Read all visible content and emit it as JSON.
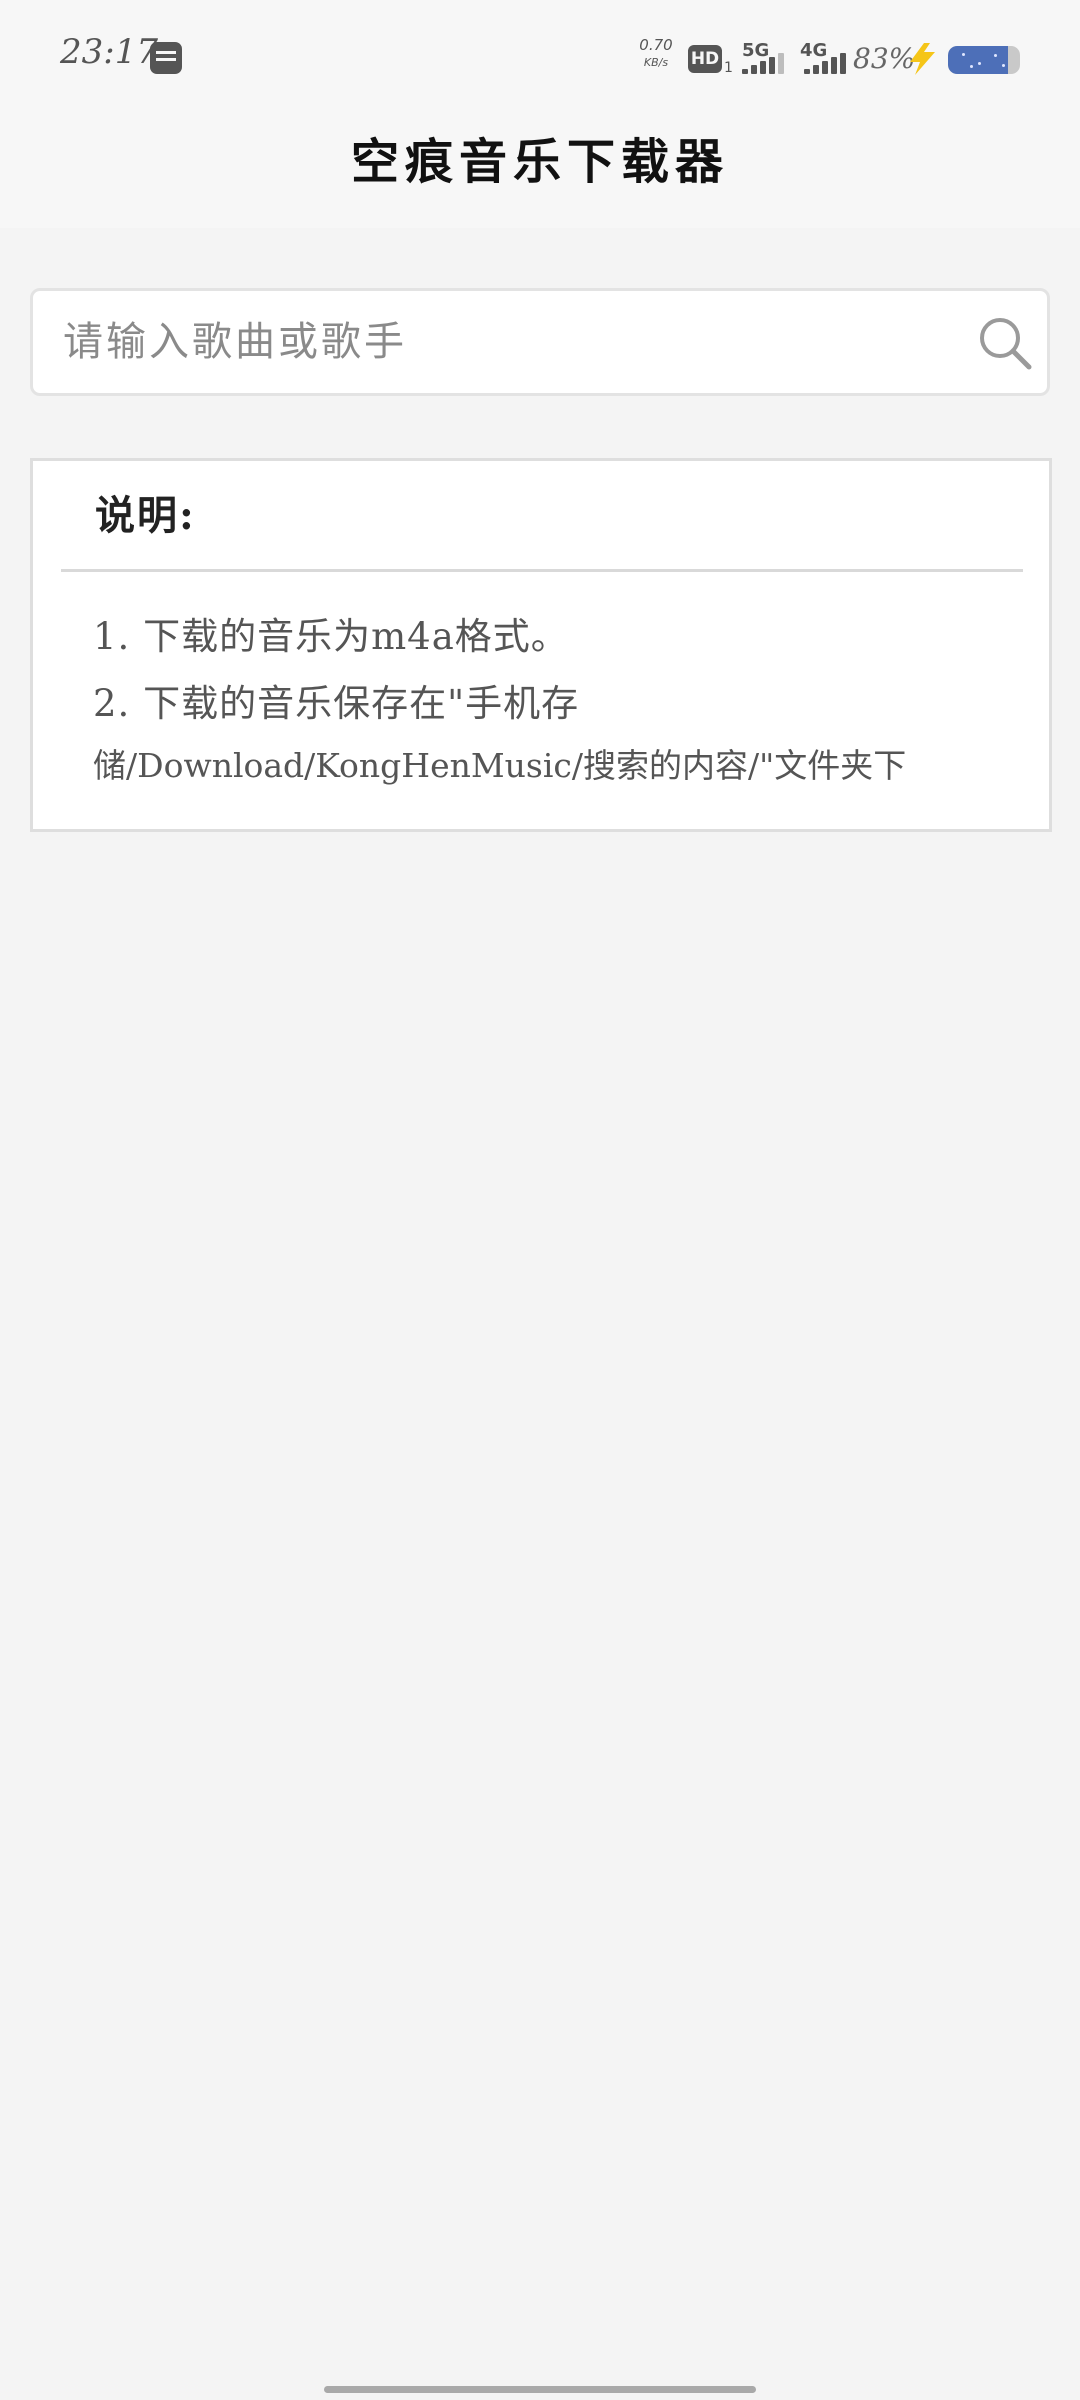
{
  "status_bar": {
    "time": "23:17",
    "network_speed_value": "0.70",
    "network_speed_unit": "KB/s",
    "hd_label": "HD",
    "hd_sub": "1",
    "signal_1_label": "5G",
    "signal_2_label": "4G",
    "battery_percent": "83%",
    "battery_level": 0.83,
    "battery_color": "#4d6fb8",
    "charging_color": "#f5c518",
    "icons": [
      "notification-icon",
      "hd-icon",
      "signal-5g-icon",
      "signal-4g-icon",
      "charging-bolt-icon",
      "battery-icon"
    ]
  },
  "app_bar": {
    "title": "空痕音乐下载器"
  },
  "search": {
    "placeholder": "请输入歌曲或歌手",
    "value": "",
    "icon": "search-icon"
  },
  "info": {
    "title": "说明:",
    "line1": "1. 下载的音乐为m4a格式。",
    "line2": "2. 下载的音乐保存在\"手机存",
    "line3": "储/Download/KongHenMusic/搜索的内容/\"文件夹下"
  }
}
